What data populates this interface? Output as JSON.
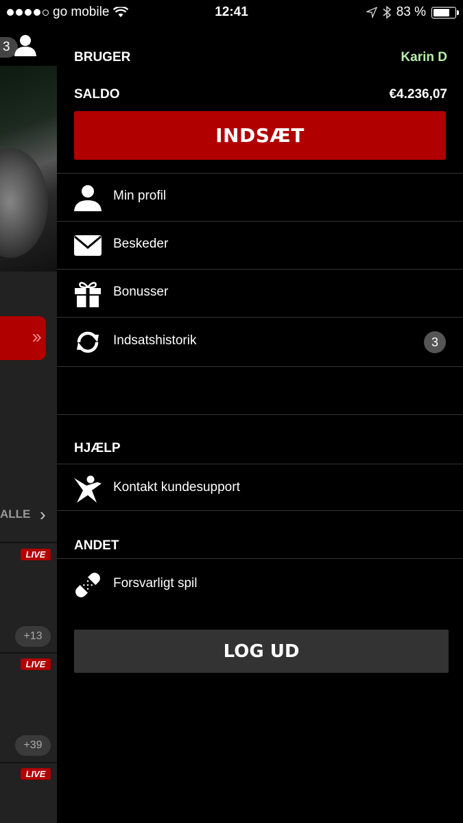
{
  "status_bar": {
    "carrier": "go mobile",
    "time": "12:41",
    "battery": "83 %",
    "battery_level": 0.83
  },
  "background": {
    "profile_badge": "3",
    "section_label": "ALLE",
    "live_label": "LIVE",
    "more_counts": [
      "+13",
      "+39"
    ]
  },
  "menu": {
    "user_label": "BRUGER",
    "user_name": "Karin  D",
    "balance_label": "SALDO",
    "balance_value": "€4.236,07",
    "deposit_button": "INDSÆT",
    "items": [
      {
        "label": "Min profil",
        "icon": "user-icon"
      },
      {
        "label": "Beskeder",
        "icon": "envelope-icon"
      },
      {
        "label": "Bonusser",
        "icon": "gift-icon"
      },
      {
        "label": "Indsatshistorik",
        "icon": "refresh-icon",
        "badge": "3"
      }
    ],
    "help_heading": "HJÆLP",
    "help_items": [
      {
        "label": "Kontakt kundesupport",
        "icon": "support-person-icon"
      }
    ],
    "other_heading": "ANDET",
    "other_items": [
      {
        "label": "Forsvarligt spil",
        "icon": "bandage-icon"
      }
    ],
    "logout_button": "LOG UD"
  }
}
